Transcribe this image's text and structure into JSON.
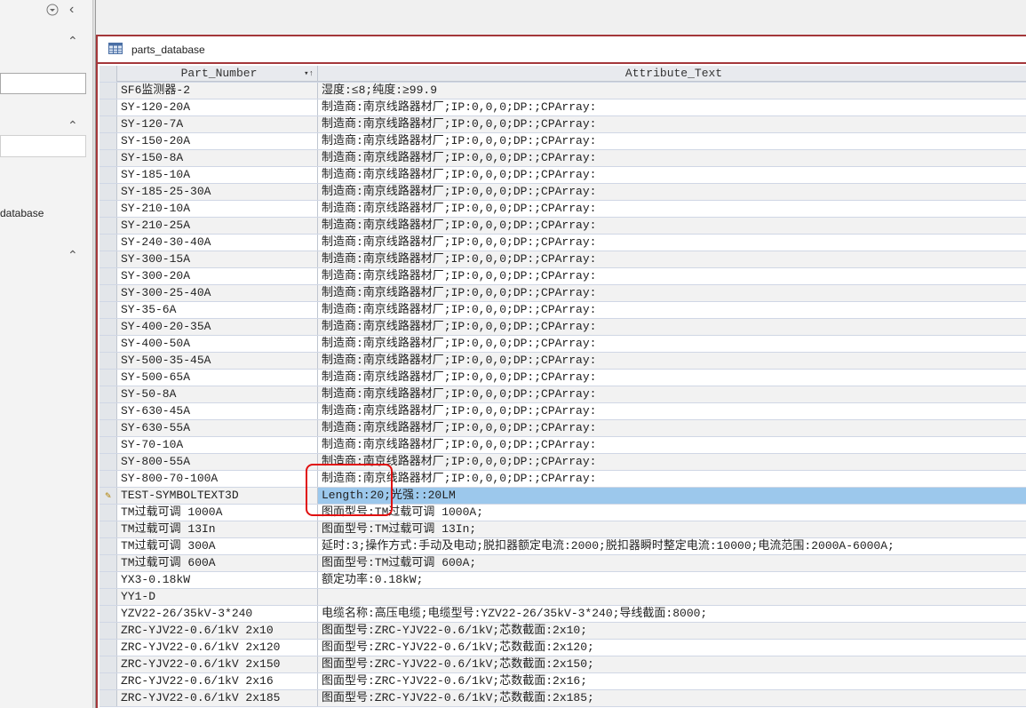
{
  "nav": {
    "item_label": "database",
    "menu_icon": "dropdown-circle-icon",
    "collapse_icon": "chevron-left-icon"
  },
  "tab": {
    "title": "parts_database",
    "icon": "table-icon"
  },
  "columns": [
    "Part_Number",
    "Attribute_Text"
  ],
  "current_row_index": 24,
  "rows": [
    [
      "SF6监测器-2",
      "湿度:≤8;纯度:≥99.9"
    ],
    [
      "SY-120-20A",
      "制造商:南京线路器材厂;IP:0,0,0;DP:;CPArray:"
    ],
    [
      "SY-120-7A",
      "制造商:南京线路器材厂;IP:0,0,0;DP:;CPArray:"
    ],
    [
      "SY-150-20A",
      "制造商:南京线路器材厂;IP:0,0,0;DP:;CPArray:"
    ],
    [
      "SY-150-8A",
      "制造商:南京线路器材厂;IP:0,0,0;DP:;CPArray:"
    ],
    [
      "SY-185-10A",
      "制造商:南京线路器材厂;IP:0,0,0;DP:;CPArray:"
    ],
    [
      "SY-185-25-30A",
      "制造商:南京线路器材厂;IP:0,0,0;DP:;CPArray:"
    ],
    [
      "SY-210-10A",
      "制造商:南京线路器材厂;IP:0,0,0;DP:;CPArray:"
    ],
    [
      "SY-210-25A",
      "制造商:南京线路器材厂;IP:0,0,0;DP:;CPArray:"
    ],
    [
      "SY-240-30-40A",
      "制造商:南京线路器材厂;IP:0,0,0;DP:;CPArray:"
    ],
    [
      "SY-300-15A",
      "制造商:南京线路器材厂;IP:0,0,0;DP:;CPArray:"
    ],
    [
      "SY-300-20A",
      "制造商:南京线路器材厂;IP:0,0,0;DP:;CPArray:"
    ],
    [
      "SY-300-25-40A",
      "制造商:南京线路器材厂;IP:0,0,0;DP:;CPArray:"
    ],
    [
      "SY-35-6A",
      "制造商:南京线路器材厂;IP:0,0,0;DP:;CPArray:"
    ],
    [
      "SY-400-20-35A",
      "制造商:南京线路器材厂;IP:0,0,0;DP:;CPArray:"
    ],
    [
      "SY-400-50A",
      "制造商:南京线路器材厂;IP:0,0,0;DP:;CPArray:"
    ],
    [
      "SY-500-35-45A",
      "制造商:南京线路器材厂;IP:0,0,0;DP:;CPArray:"
    ],
    [
      "SY-500-65A",
      "制造商:南京线路器材厂;IP:0,0,0;DP:;CPArray:"
    ],
    [
      "SY-50-8A",
      "制造商:南京线路器材厂;IP:0,0,0;DP:;CPArray:"
    ],
    [
      "SY-630-45A",
      "制造商:南京线路器材厂;IP:0,0,0;DP:;CPArray:"
    ],
    [
      "SY-630-55A",
      "制造商:南京线路器材厂;IP:0,0,0;DP:;CPArray:"
    ],
    [
      "SY-70-10A",
      "制造商:南京线路器材厂;IP:0,0,0;DP:;CPArray:"
    ],
    [
      "SY-800-55A",
      "制造商:南京线路器材厂;IP:0,0,0;DP:;CPArray:"
    ],
    [
      "SY-800-70-100A",
      "制造商:南京线路器材厂;IP:0,0,0;DP:;CPArray:"
    ],
    [
      "TEST-SYMBOLTEXT3D",
      "Length:20;光强::20LM"
    ],
    [
      "TM过载可调 1000A",
      "图面型号:TM过载可调 1000A;"
    ],
    [
      "TM过载可调 13In",
      "图面型号:TM过载可调 13In;"
    ],
    [
      "TM过载可调 300A",
      "延时:3;操作方式:手动及电动;脱扣器额定电流:2000;脱扣器瞬时整定电流:10000;电流范围:2000A-6000A;"
    ],
    [
      "TM过载可调 600A",
      "图面型号:TM过载可调 600A;"
    ],
    [
      "YX3-0.18kW",
      "额定功率:0.18kW;"
    ],
    [
      "YY1-D",
      ""
    ],
    [
      "YZV22-26/35kV-3*240",
      "电缆名称:高压电缆;电缆型号:YZV22-26/35kV-3*240;导线截面:8000;"
    ],
    [
      "ZRC-YJV22-0.6/1kV 2x10",
      "图面型号:ZRC-YJV22-0.6/1kV;芯数截面:2x10;"
    ],
    [
      "ZRC-YJV22-0.6/1kV 2x120",
      "图面型号:ZRC-YJV22-0.6/1kV;芯数截面:2x120;"
    ],
    [
      "ZRC-YJV22-0.6/1kV 2x150",
      "图面型号:ZRC-YJV22-0.6/1kV;芯数截面:2x150;"
    ],
    [
      "ZRC-YJV22-0.6/1kV 2x16",
      "图面型号:ZRC-YJV22-0.6/1kV;芯数截面:2x16;"
    ],
    [
      "ZRC-YJV22-0.6/1kV 2x185",
      "图面型号:ZRC-YJV22-0.6/1kV;芯数截面:2x185;"
    ]
  ]
}
